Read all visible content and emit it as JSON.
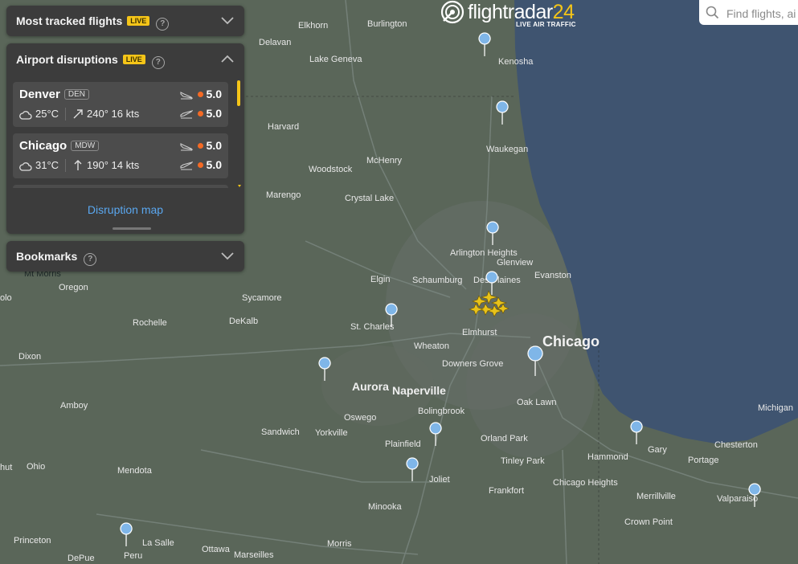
{
  "app": {
    "logo_main": "flightradar",
    "logo_num": "24",
    "logo_sub": "LIVE AIR TRAFFIC"
  },
  "search": {
    "placeholder": "Find flights, ai"
  },
  "panels": {
    "most_tracked": {
      "title": "Most tracked flights",
      "live": "LIVE",
      "help": "?"
    },
    "disruptions": {
      "title": "Airport disruptions",
      "live": "LIVE",
      "help": "?",
      "airports": [
        {
          "city": "Denver",
          "code": "DEN",
          "temp": "25°C",
          "wind": "240° 16 kts",
          "arrivals": "5.0",
          "departures": "5.0",
          "wind_dir_deg": 240
        },
        {
          "city": "Chicago",
          "code": "MDW",
          "temp": "31°C",
          "wind": "190° 14 kts",
          "arrivals": "5.0",
          "departures": "5.0",
          "wind_dir_deg": 190
        }
      ],
      "link": "Disruption map"
    },
    "bookmarks": {
      "title": "Bookmarks",
      "help": "?"
    }
  },
  "map_labels": {
    "big": [
      "Chicago"
    ],
    "medium": [
      "Aurora",
      "Naperville"
    ],
    "small": [
      "Elkhorn",
      "Burlington",
      "Kenosha",
      "Delavan",
      "Lake Geneva",
      "Harvard",
      "McHenry",
      "Waukegan",
      "Woodstock",
      "Crystal Lake",
      "Marengo",
      "Arlington Heights",
      "Glenview",
      "Elgin",
      "Schaumburg",
      "Des Plaines",
      "Evanston",
      "Mt Morris",
      "Oregon",
      "Sycamore",
      "Rochelle",
      "DeKalb",
      "St. Charles",
      "Elmhurst",
      "Wheaton",
      "Downers Grove",
      "Dixon",
      "Amboy",
      "Oswego",
      "Bolingbrook",
      "Oak Lawn",
      "Sandwich",
      "Yorkville",
      "Plainfield",
      "Orland Park",
      "Tinley Park",
      "Hammond",
      "Gary",
      "Chesterton",
      "Portage",
      "Michigan",
      "Mendota",
      "Joliet",
      "Frankfort",
      "Chicago Heights",
      "Merrillville",
      "Minooka",
      "Valparaiso",
      "Crown Point",
      "Princeton",
      "La Salle",
      "Ottawa",
      "Peru",
      "Morris",
      "Marseilles",
      "DePue",
      "Ohio",
      "olo",
      "hut"
    ]
  },
  "colors": {
    "land": "#5a6659",
    "lake": "#3f5470",
    "panel": "#3c3c3c",
    "card": "#4c4c4c",
    "live_badge": "#f5c518",
    "status_dot": "#f46a24",
    "link": "#5aa7ef",
    "aircraft": "#f5c518"
  }
}
